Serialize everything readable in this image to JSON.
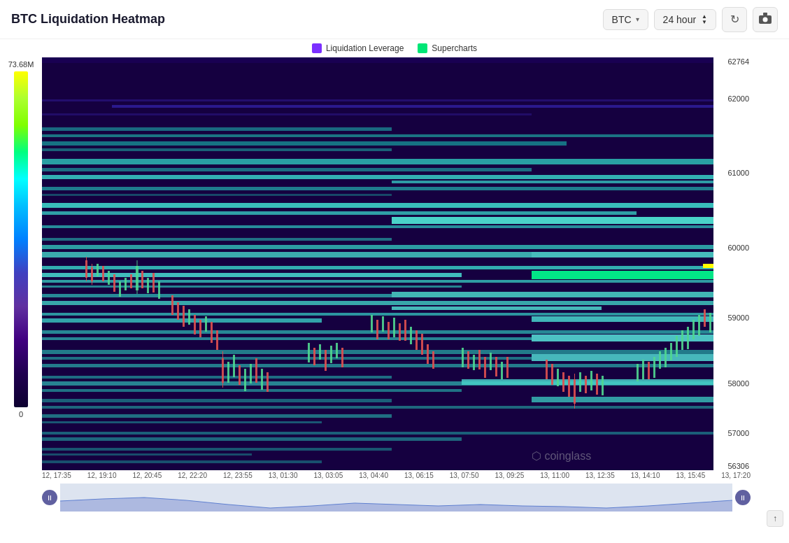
{
  "header": {
    "title": "BTC Liquidation Heatmap",
    "btc_selector": "BTC",
    "time_selector": "24 hour",
    "btc_chevron": "▾",
    "time_up": "▲",
    "time_down": "▼"
  },
  "legend": {
    "leverage_label": "Liquidation Leverage",
    "supercharts_label": "Supercharts",
    "leverage_color": "#7b2fff",
    "supercharts_color": "#00e676"
  },
  "scale": {
    "max": "73.68M",
    "min": "0"
  },
  "y_axis": {
    "labels": [
      "62764",
      "62000",
      "61000",
      "60000",
      "59000",
      "58000",
      "57000",
      "56306"
    ]
  },
  "x_axis": {
    "labels": [
      "12, 17:35",
      "12, 19:10",
      "12, 20:45",
      "12, 22:20",
      "12, 23:55",
      "13, 01:30",
      "13, 03:05",
      "13, 04:40",
      "13, 06:15",
      "13, 07:50",
      "13, 09:25",
      "13, 11:00",
      "13, 12:35",
      "13, 14:10",
      "13, 15:45",
      "13, 17:20"
    ]
  },
  "watermark": {
    "text": "coinglass"
  },
  "icons": {
    "refresh": "↻",
    "camera": "📷",
    "pause": "⏸",
    "scroll_up": "↑"
  }
}
